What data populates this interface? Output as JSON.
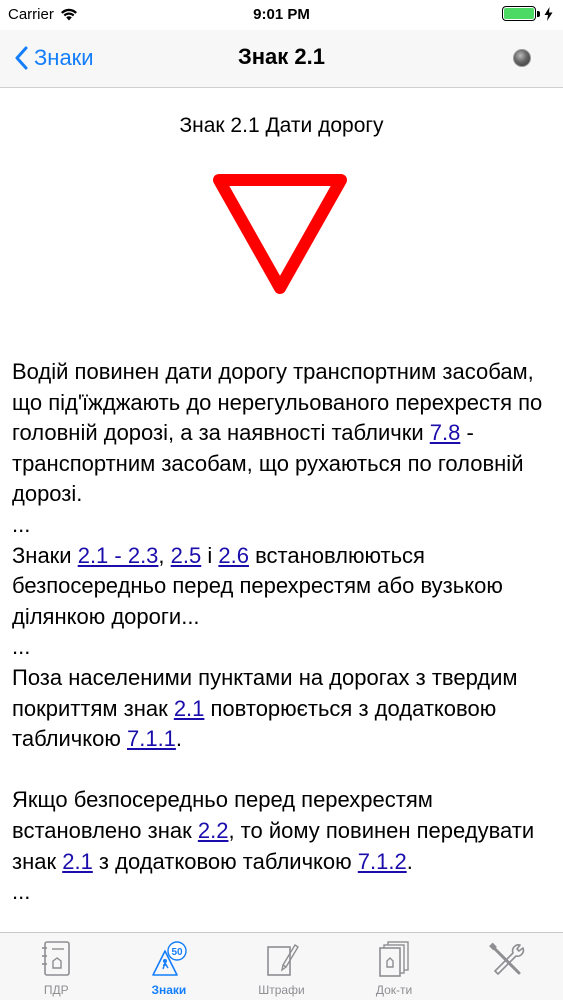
{
  "status_bar": {
    "carrier": "Carrier",
    "time": "9:01 PM"
  },
  "nav": {
    "back_label": "Знаки",
    "title": "Знак 2.1"
  },
  "content": {
    "sign_title": "Знак 2.1 Дати дорогу",
    "para1": {
      "t1": "Водій повинен дати дорогу транспортним засобам, що під'їжджають до нерегульованого перехрестя по головній дорозі, а за наявності таблички ",
      "link1": "7.8",
      "t2": " - транспортним засобам, що рухаються по головній дорозі."
    },
    "ellipsis": "...",
    "para2": {
      "t1": "Знаки ",
      "link1": "2.1 - 2.3",
      "t2": ", ",
      "link2": "2.5",
      "t3": " і ",
      "link3": "2.6",
      "t4": " встановлюються безпосередньо перед перехрестям або вузькою ділянкою дороги..."
    },
    "para3": {
      "t1": "Поза населеними пунктами на дорогах з твердим покриттям знак ",
      "link1": "2.1",
      "t2": " повторюється з додатковою табличкою ",
      "link2": "7.1.1",
      "t3": "."
    },
    "para4": {
      "t1": "Якщо безпосередньо перед перехрестям встановлено знак ",
      "link1": "2.2",
      "t2": ", то йому повинен передувати знак ",
      "link2": "2.1",
      "t3": " з додатковою табличкою ",
      "link3": "7.1.2",
      "t4": "."
    }
  },
  "tabs": [
    {
      "label": "ПДР",
      "icon": "rulebook-icon"
    },
    {
      "label": "Знаки",
      "icon": "road-sign-icon",
      "badge": "50"
    },
    {
      "label": "Штрафи",
      "icon": "fine-document-icon"
    },
    {
      "label": "Док-ти",
      "icon": "documents-icon"
    },
    {
      "label": "",
      "icon": "tools-icon"
    }
  ],
  "colors": {
    "accent": "#147efb",
    "link": "#1a0dab",
    "sign_border": "#ff0000"
  }
}
